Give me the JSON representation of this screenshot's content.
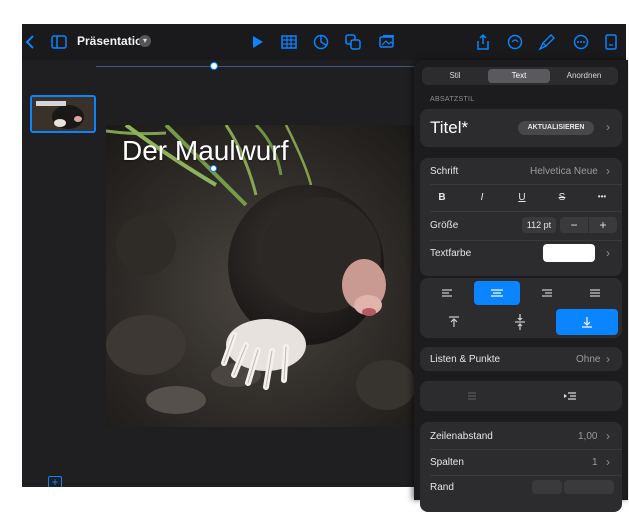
{
  "toolbar": {
    "doc_title": "Präsentation",
    "icons": [
      "back-icon",
      "sidebar-icon",
      "play-icon",
      "table-icon",
      "chart-icon",
      "shape-icon",
      "media-icon",
      "share-icon",
      "collab-icon",
      "format-brush-icon",
      "more-icon",
      "document-icon"
    ]
  },
  "slide": {
    "title": "Der Maulwurf"
  },
  "panel": {
    "tabs": [
      {
        "label": "Stil",
        "active": false
      },
      {
        "label": "Text",
        "active": true
      },
      {
        "label": "Anordnen",
        "active": false
      }
    ],
    "section_label": "ABSATZSTIL",
    "paragraph_style": "Titel*",
    "update_button": "AKTUALISIEREN",
    "font_label": "Schrift",
    "font_value": "Helvetica Neue",
    "text_styles": [
      "B",
      "I",
      "U",
      "S",
      "•••"
    ],
    "size_label": "Größe",
    "size_value": "112 pt",
    "size_minus": "−",
    "size_plus": "+",
    "color_label": "Textfarbe",
    "text_color": "#ffffff",
    "lists_label": "Listen & Punkte",
    "lists_value": "Ohne",
    "line_spacing_label": "Zeilenabstand",
    "line_spacing_value": "1,00",
    "columns_label": "Spalten",
    "columns_value": "1",
    "margin_label": "Rand"
  },
  "colors": {
    "accent": "#0a84ff",
    "panel_bg": "#1c1c1e",
    "group_bg": "#2c2c2e"
  }
}
